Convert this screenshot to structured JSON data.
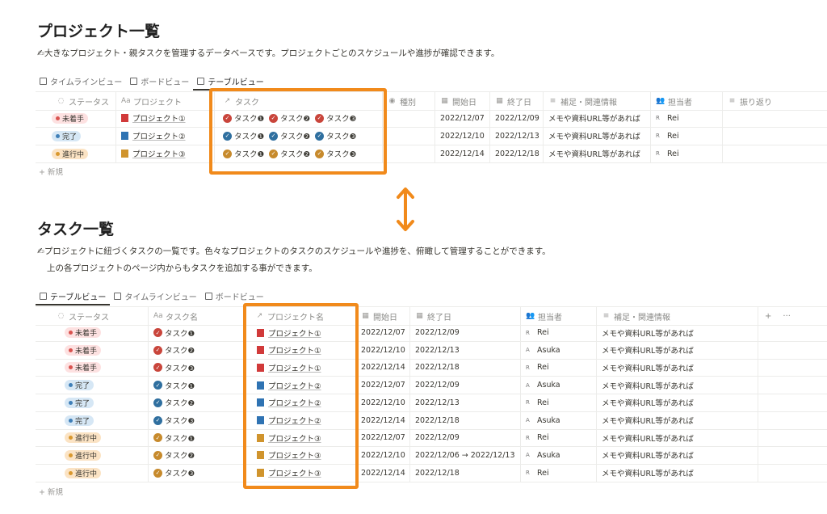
{
  "colors": {
    "accent": "#f18a1b",
    "red": "#d9534f",
    "blue": "#3f7fb8",
    "orange": "#d9982e"
  },
  "projects": {
    "title": "プロジェクト一覧",
    "emoji": "✍",
    "description": "大きなプロジェクト・親タスクを管理するデータベースです。プロジェクトごとのスケジュールや進捗が確認できます。",
    "tabs": [
      {
        "label": "タイムラインビュー",
        "icon": "timeline-icon",
        "active": false
      },
      {
        "label": "ボードビュー",
        "icon": "board-icon",
        "active": false
      },
      {
        "label": "テーブルビュー",
        "icon": "table-icon",
        "active": true
      }
    ],
    "columns": [
      "ステータス",
      "プロジェクト",
      "タスク",
      "種別",
      "開始日",
      "終了日",
      "補足・関連情報",
      "担当者",
      "振り返り"
    ],
    "column_icons": {
      "status": "◌",
      "project": "Aa",
      "task": "↗",
      "type": "◉",
      "start": "▦",
      "end": "▦",
      "note": "≡",
      "owner": "👥",
      "review": "≡"
    },
    "rows": [
      {
        "status": "未着手",
        "project": "プロジェクト①",
        "tasks": [
          "タスク❶",
          "タスク❷",
          "タスク❸"
        ],
        "start": "2022/12/07",
        "end": "2022/12/09",
        "note": "メモや資料URL等があれば",
        "owner_initial": "R",
        "owner": "Rei"
      },
      {
        "status": "完了",
        "project": "プロジェクト②",
        "tasks": [
          "タスク❶",
          "タスク❷",
          "タスク❸"
        ],
        "start": "2022/12/10",
        "end": "2022/12/13",
        "note": "メモや資料URL等があれば",
        "owner_initial": "R",
        "owner": "Rei"
      },
      {
        "status": "進行中",
        "project": "プロジェクト③",
        "tasks": [
          "タスク❶",
          "タスク❷",
          "タスク❸"
        ],
        "start": "2022/12/14",
        "end": "2022/12/18",
        "note": "メモや資料URL等があれば",
        "owner_initial": "R",
        "owner": "Rei"
      }
    ],
    "new_label": "新規"
  },
  "tasks": {
    "title": "タスク一覧",
    "emoji": "✍",
    "description1": "プロジェクトに紐づくタスクの一覧です。色々なプロジェクトのタスクのスケジュールや進捗を、俯瞰して管理することができます。",
    "description2": "上の各プロジェクトのページ内からもタスクを追加する事ができます。",
    "tabs": [
      {
        "label": "テーブルビュー",
        "icon": "table-icon",
        "active": true
      },
      {
        "label": "タイムラインビュー",
        "icon": "timeline-icon",
        "active": false
      },
      {
        "label": "ボードビュー",
        "icon": "board-icon",
        "active": false
      }
    ],
    "columns": [
      "ステータス",
      "タスク名",
      "プロジェクト名",
      "開始日",
      "終了日",
      "担当者",
      "補足・関連情報"
    ],
    "add_column": "+",
    "more": "···",
    "rows": [
      {
        "status": "未着手",
        "task": "タスク❶",
        "project": "プロジェクト①",
        "start": "2022/12/07",
        "end": "2022/12/09",
        "owner_initial": "R",
        "owner": "Rei",
        "note": "メモや資料URL等があれば"
      },
      {
        "status": "未着手",
        "task": "タスク❷",
        "project": "プロジェクト①",
        "start": "2022/12/10",
        "end": "2022/12/13",
        "owner_initial": "A",
        "owner": "Asuka",
        "note": "メモや資料URL等があれば"
      },
      {
        "status": "未着手",
        "task": "タスク❸",
        "project": "プロジェクト①",
        "start": "2022/12/14",
        "end": "2022/12/18",
        "owner_initial": "R",
        "owner": "Rei",
        "note": "メモや資料URL等があれば"
      },
      {
        "status": "完了",
        "task": "タスク❶",
        "project": "プロジェクト②",
        "start": "2022/12/07",
        "end": "2022/12/09",
        "owner_initial": "A",
        "owner": "Asuka",
        "note": "メモや資料URL等があれば"
      },
      {
        "status": "完了",
        "task": "タスク❷",
        "project": "プロジェクト②",
        "start": "2022/12/10",
        "end": "2022/12/13",
        "owner_initial": "R",
        "owner": "Rei",
        "note": "メモや資料URL等があれば"
      },
      {
        "status": "完了",
        "task": "タスク❸",
        "project": "プロジェクト②",
        "start": "2022/12/14",
        "end": "2022/12/18",
        "owner_initial": "A",
        "owner": "Asuka",
        "note": "メモや資料URL等があれば"
      },
      {
        "status": "進行中",
        "task": "タスク❶",
        "project": "プロジェクト③",
        "start": "2022/12/07",
        "end": "2022/12/09",
        "owner_initial": "R",
        "owner": "Rei",
        "note": "メモや資料URL等があれば"
      },
      {
        "status": "進行中",
        "task": "タスク❷",
        "project": "プロジェクト③",
        "start": "2022/12/10",
        "end": "2022/12/06 → 2022/12/13",
        "owner_initial": "A",
        "owner": "Asuka",
        "note": "メモや資料URL等があれば"
      },
      {
        "status": "進行中",
        "task": "タスク❸",
        "project": "プロジェクト③",
        "start": "2022/12/14",
        "end": "2022/12/18",
        "owner_initial": "R",
        "owner": "Rei",
        "note": "メモや資料URL等があれば"
      }
    ],
    "new_label": "新規"
  }
}
